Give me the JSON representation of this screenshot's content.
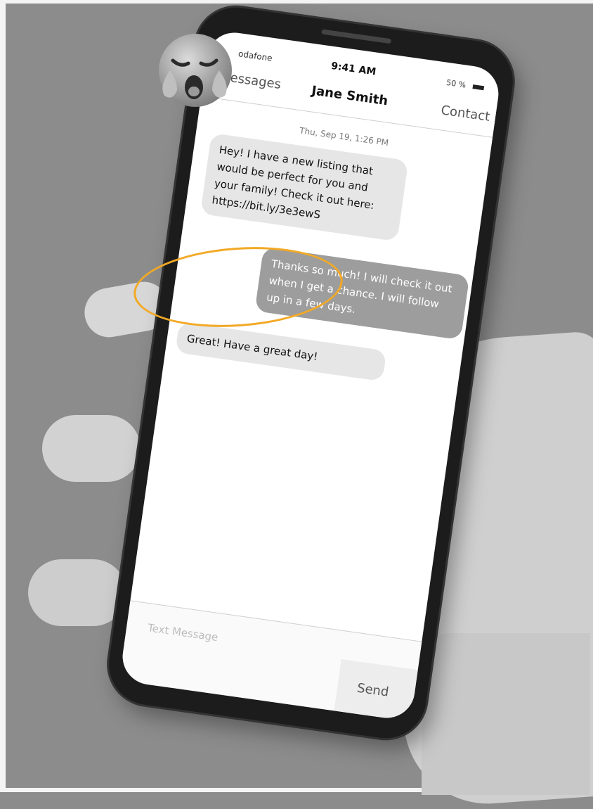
{
  "status_bar": {
    "carrier": "odafone",
    "time": "9:41 AM",
    "battery": "50 %"
  },
  "nav": {
    "back_label": "Messages",
    "title": "Jane Smith",
    "contact_label": "Contact"
  },
  "thread": {
    "date": "Thu, Sep 19, 1:26 PM",
    "messages": [
      {
        "direction": "incoming",
        "text": "Hey! I have a new listing that would be perfect for you and your family! Check it out here:",
        "link": "https://bit.ly/3e3ewS"
      },
      {
        "direction": "outgoing",
        "text": "Thanks so much! I will check it out when I get a chance. I will follow up in a few days."
      },
      {
        "direction": "incoming",
        "text": "Great! Have a great day!"
      }
    ]
  },
  "compose": {
    "placeholder": "Text Message",
    "send_label": "Send"
  },
  "overlay": {
    "highlight_color": "#f2a926",
    "emoji": "crying-face-icon"
  }
}
